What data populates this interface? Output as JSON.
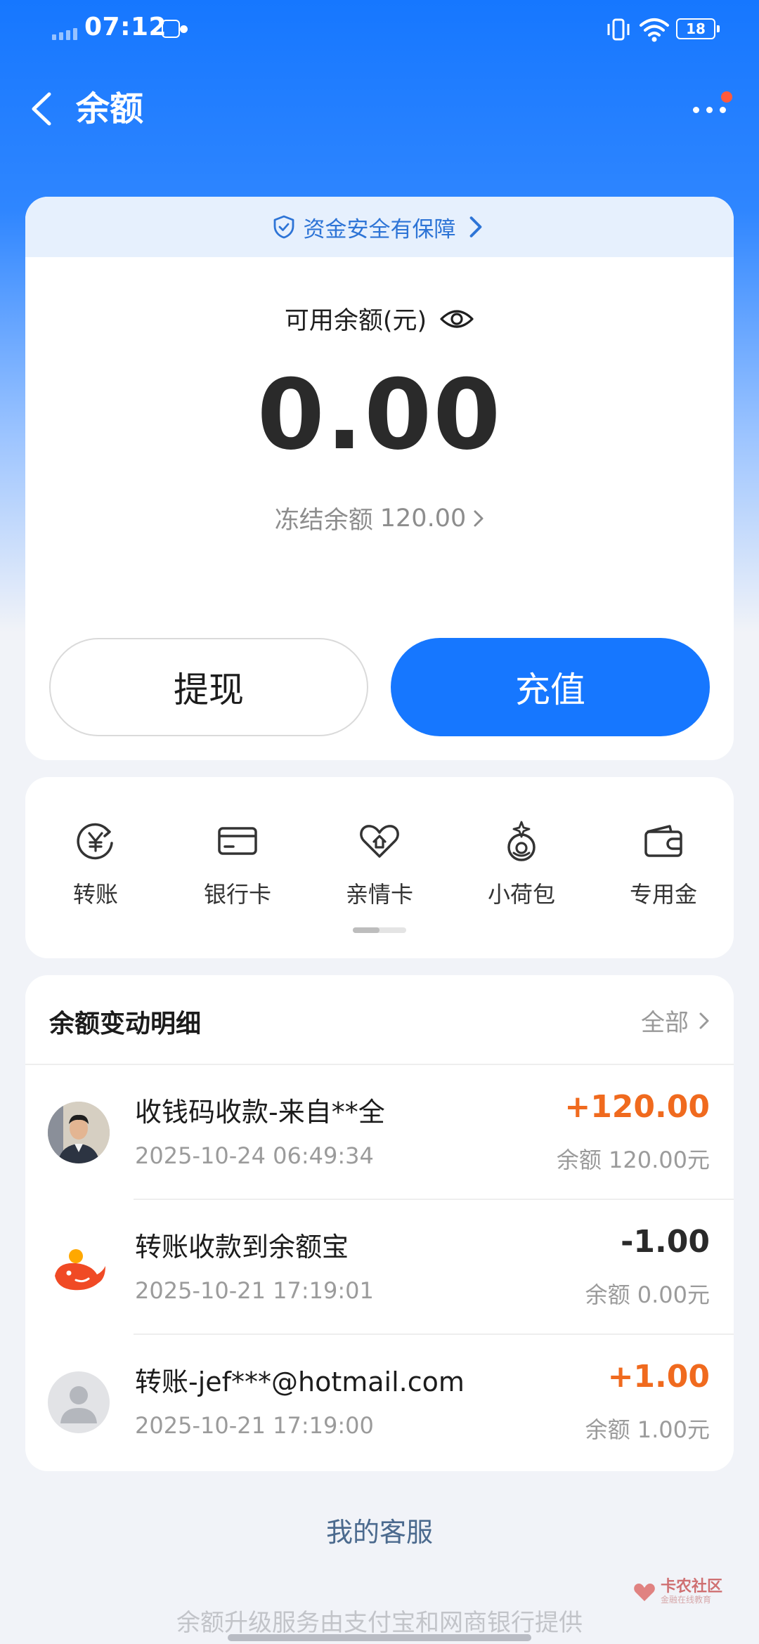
{
  "status_bar": {
    "time": "07:12",
    "battery": "18"
  },
  "header": {
    "title": "余额"
  },
  "balance": {
    "safety_text": "资金安全有保障",
    "available_label": "可用余额(元)",
    "available_amount": "0.00",
    "frozen_label": "冻结余额",
    "frozen_amount": "120.00",
    "withdraw_label": "提现",
    "recharge_label": "充值"
  },
  "shortcuts": [
    {
      "label": "转账",
      "icon": "transfer-yuan-icon"
    },
    {
      "label": "银行卡",
      "icon": "bank-card-icon"
    },
    {
      "label": "亲情卡",
      "icon": "family-card-icon"
    },
    {
      "label": "小荷包",
      "icon": "small-purse-icon"
    },
    {
      "label": "专用金",
      "icon": "wallet-icon"
    }
  ],
  "transactions": {
    "title": "余额变动明细",
    "filter": "全部",
    "items": [
      {
        "name": "收钱码收款-来自**全",
        "time": "2025-10-24 06:49:34",
        "amount": "+120.00",
        "balance_after": "余额 120.00元",
        "amount_color": "#f06a1e",
        "avatar": "photo-avatar"
      },
      {
        "name": "转账收款到余额宝",
        "time": "2025-10-21 17:19:01",
        "amount": "-1.00",
        "balance_after": "余额 0.00元",
        "amount_color": "#2a2a2a",
        "avatar": "yuebao-logo"
      },
      {
        "name": "转账-jef***@hotmail.com",
        "time": "2025-10-21 17:19:00",
        "amount": "+1.00",
        "balance_after": "余额 1.00元",
        "amount_color": "#f06a1e",
        "avatar": "default-user-avatar"
      }
    ]
  },
  "service_link": "我的客服",
  "footer_note": "余额升级服务由支付宝和网商银行提供",
  "watermark": {
    "text": "卡农社区",
    "sub": "金融在线教育"
  },
  "colors": {
    "brand_blue": "#1677ff",
    "income_orange": "#f06a1e"
  }
}
